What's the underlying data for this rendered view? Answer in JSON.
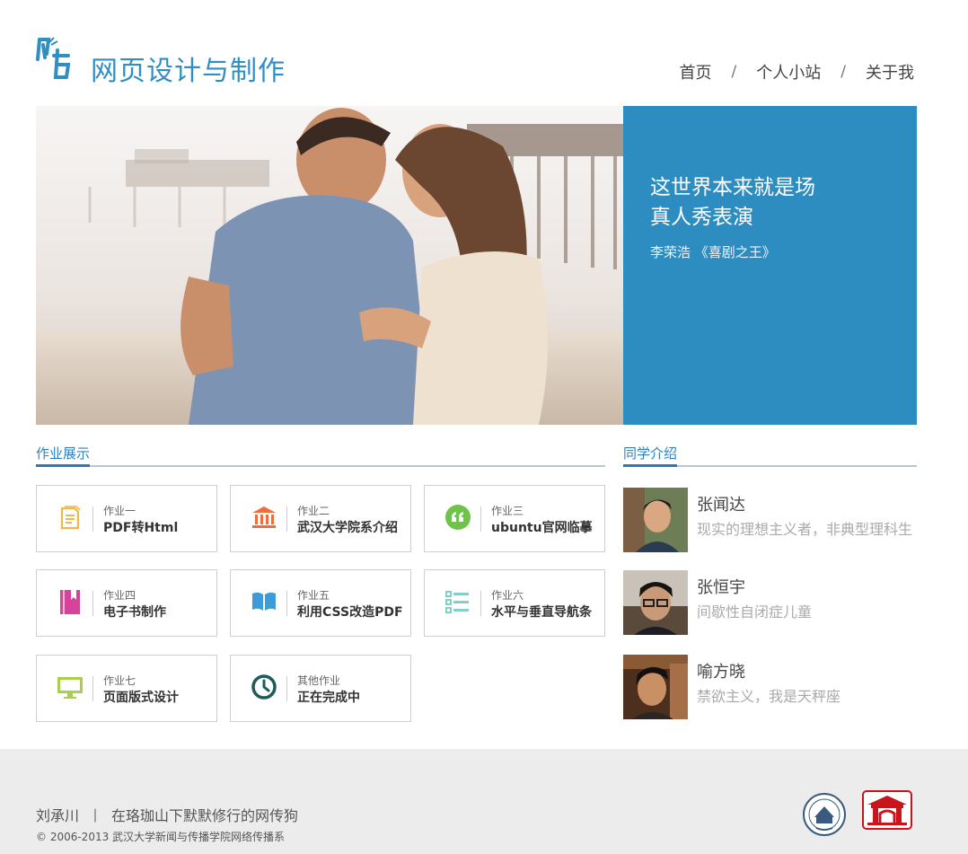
{
  "header": {
    "site_title": "网页设计与制作",
    "nav": [
      {
        "label": "首页"
      },
      {
        "label": "个人小站"
      },
      {
        "label": "关于我"
      }
    ],
    "nav_separator": "/"
  },
  "hero": {
    "quote_line1": "这世界本来就是场",
    "quote_line2": "真人秀表演",
    "quote_source": "李荣浩 《喜剧之王》"
  },
  "works": {
    "heading": "作业展示",
    "items": [
      {
        "small": "作业一",
        "big": "PDF转Html",
        "icon": "document-icon",
        "color": "#f0b84a"
      },
      {
        "small": "作业二",
        "big": "武汉大学院系介绍",
        "icon": "bank-icon",
        "color": "#f26b3a"
      },
      {
        "small": "作业三",
        "big": "ubuntu官网临摹",
        "icon": "quote-icon",
        "color": "#6fc24a"
      },
      {
        "small": "作业四",
        "big": "电子书制作",
        "icon": "ebook-icon",
        "color": "#d6449a"
      },
      {
        "small": "作业五",
        "big": "利用CSS改造PDF",
        "icon": "open-book-icon",
        "color": "#3d9bd8"
      },
      {
        "small": "作业六",
        "big": "水平与垂直导航条",
        "icon": "list-icon",
        "color": "#86cfc5"
      },
      {
        "small": "作业七",
        "big": "页面版式设计",
        "icon": "monitor-icon",
        "color": "#a8d04a"
      },
      {
        "small": "其他作业",
        "big": "正在完成中",
        "icon": "clock-icon",
        "color": "#1f5b58"
      }
    ]
  },
  "people": {
    "heading": "同学介绍",
    "items": [
      {
        "name": "张闻达",
        "bio": "现实的理想主义者，非典型理科生"
      },
      {
        "name": "张恒宇",
        "bio": "间歇性自闭症儿童"
      },
      {
        "name": "喻方晓",
        "bio": "禁欲主义，我是天秤座"
      }
    ]
  },
  "footer": {
    "author": "刘承川",
    "separator": "丨",
    "tagline": "在珞珈山下默默修行的网传狗",
    "copyright": "© 2006-2013 武汉大学新闻与传播学院网络传播系"
  }
}
